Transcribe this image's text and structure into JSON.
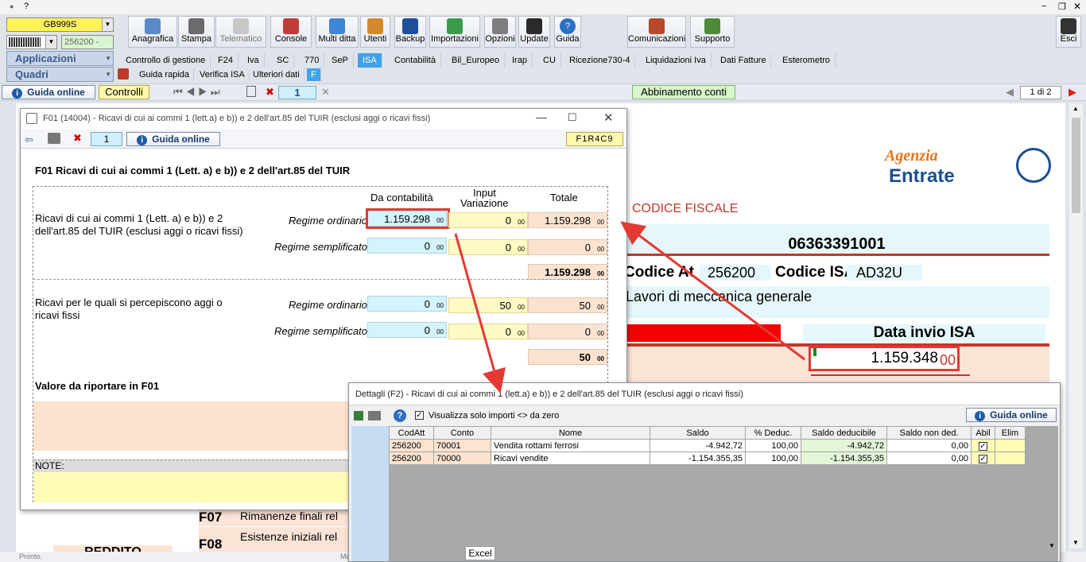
{
  "app": {
    "top_icon": "?",
    "combo_code": "GB999S",
    "combo_num": "256200 -",
    "menu_applicazioni": "Applicazioni",
    "menu_quadri": "Quadri"
  },
  "toolbar": [
    "Anagrafica",
    "Stampa",
    "Telematico",
    "Console",
    "Multi ditta",
    "Utenti",
    "Backup",
    "Importazioni",
    "Opzioni",
    "Update",
    "Guida"
  ],
  "toolbar_right": [
    "Comunicazioni",
    "Supporto"
  ],
  "esci": "Esci",
  "tabs": [
    "Controllo di gestione",
    "F24",
    "Iva",
    "SC",
    "770",
    "SeP",
    "ISA",
    "Contabilità",
    "Bil_Europeo",
    "Irap",
    "CU",
    "Ricezione730-4",
    "Liquidazioni Iva",
    "Dati Fatture",
    "Esterometro"
  ],
  "active_tab": "ISA",
  "subtabs": [
    "Guida rapida",
    "Verifica ISA",
    "Ulteriori dati",
    "F"
  ],
  "nav": {
    "guida_online": "Guida online",
    "controlli": "Controlli",
    "page_num": "1",
    "abbinamento": "Abbinamento conti",
    "pages": "1 di 2"
  },
  "document": {
    "logo_top": "genzia",
    "logo_bottom": "ntrate",
    "codice_fiscale_label": "CODICE FISCALE",
    "codice_fiscale": "06363391001",
    "codice_att_label": "Codice At",
    "codice_att": "256200",
    "codice_isa_label": "Codice ISA",
    "codice_isa": "AD32U",
    "descrizione": "Lavori di meccanica generale",
    "data_invio": "Data invio ISA",
    "valore": "1.159.348",
    "valore_dec": "00",
    "rows": [
      {
        "code": "F07",
        "text": "Rimanenze finali rel"
      },
      {
        "code": "F08",
        "text": "Esistenze iniziali rel"
      }
    ],
    "reddito": "REDDITO"
  },
  "f01": {
    "title": "F01 (14004) - Ricavi di cui ai commi 1 (lett.a) e b)) e 2 dell'art.85 del TUIR (esclusi aggi o ricavi fissi)",
    "page": "1",
    "guida": "Guida online",
    "code": "F1R4C9",
    "heading": "F01 Ricavi di cui ai commi 1 (Lett. a) e b)) e 2 dell'art.85 del TUIR",
    "col_contabilita": "Da  contabilità",
    "col_input": "Input",
    "col_variazione": "Variazione",
    "col_totale": "Totale",
    "sec1_label": "Ricavi di cui ai commi 1 (Lett. a) e b)) e 2 dell'art.85 del TUIR (esclusi aggi o ricavi fissi)",
    "sec2_label": "Ricavi per le quali si percepiscono aggi o ricavi fissi",
    "regime_ordinario": "Regime ordinario",
    "regime_semplificato": "Regime semplificato",
    "s1_ord": [
      "1.159.298",
      "0",
      "1.159.298"
    ],
    "s1_sem": [
      "0",
      "0",
      "0"
    ],
    "s1_tot": "1.159.298",
    "s2_ord": [
      "0",
      "50",
      "50"
    ],
    "s2_sem": [
      "0",
      "0",
      "0"
    ],
    "s2_tot": "50",
    "dec": "00",
    "valore_label": "Valore da riportare in F01",
    "note_label": "NOTE:"
  },
  "dettagli": {
    "title": "Dettagli (F2) - Ricavi di cui ai commi 1 (lett.a) e b)) e 2 dell'art.85 del TUIR (esclusi aggi o ricavi fissi)",
    "checkbox_label": "Visualizza solo importi <> da zero",
    "guida": "Guida online",
    "headers": [
      "CodAtt",
      "Conto",
      "Nome",
      "Saldo",
      "% Deduc.",
      "Saldo deducibile",
      "Saldo non ded.",
      "Abil",
      "Elim"
    ],
    "rows": [
      [
        "256200",
        "70001",
        "Vendita rottami ferrosi",
        "-4.942,72",
        "100,00",
        "-4.942,72",
        "0,00"
      ],
      [
        "256200",
        "70000",
        "Ricavi vendite",
        "-1.154.355,35",
        "100,00",
        "-1.154.355,35",
        "0,00"
      ]
    ],
    "excel": "Excel"
  },
  "status": {
    "pronto": "Pronto.",
    "ma": "Ma"
  },
  "colors": {
    "accent": "#3fa3e8",
    "highlight_red": "#e53935",
    "cyan": "#d4f3fb",
    "yellow": "#fff9c4",
    "peach": "#fbe3d0"
  }
}
